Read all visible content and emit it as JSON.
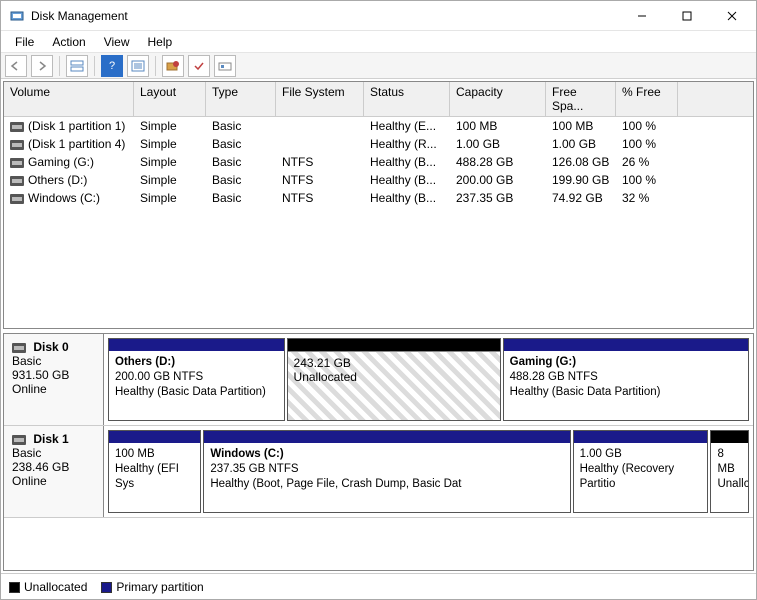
{
  "window": {
    "title": "Disk Management"
  },
  "menu": {
    "file": "File",
    "action": "Action",
    "view": "View",
    "help": "Help"
  },
  "list": {
    "headers": {
      "volume": "Volume",
      "layout": "Layout",
      "type": "Type",
      "filesystem": "File System",
      "status": "Status",
      "capacity": "Capacity",
      "freespace": "Free Spa...",
      "pctfree": "% Free"
    },
    "rows": [
      {
        "volume": "(Disk 1 partition 1)",
        "layout": "Simple",
        "type": "Basic",
        "fs": "",
        "status": "Healthy (E...",
        "capacity": "100 MB",
        "free": "100 MB",
        "pfree": "100 %"
      },
      {
        "volume": "(Disk 1 partition 4)",
        "layout": "Simple",
        "type": "Basic",
        "fs": "",
        "status": "Healthy (R...",
        "capacity": "1.00 GB",
        "free": "1.00 GB",
        "pfree": "100 %"
      },
      {
        "volume": "Gaming (G:)",
        "layout": "Simple",
        "type": "Basic",
        "fs": "NTFS",
        "status": "Healthy (B...",
        "capacity": "488.28 GB",
        "free": "126.08 GB",
        "pfree": "26 %"
      },
      {
        "volume": "Others (D:)",
        "layout": "Simple",
        "type": "Basic",
        "fs": "NTFS",
        "status": "Healthy (B...",
        "capacity": "200.00 GB",
        "free": "199.90 GB",
        "pfree": "100 %"
      },
      {
        "volume": "Windows (C:)",
        "layout": "Simple",
        "type": "Basic",
        "fs": "NTFS",
        "status": "Healthy (B...",
        "capacity": "237.35 GB",
        "free": "74.92 GB",
        "pfree": "32 %"
      }
    ]
  },
  "disks": {
    "d0": {
      "name": "Disk 0",
      "type": "Basic",
      "size": "931.50 GB",
      "status": "Online",
      "p0": {
        "name": "Others  (D:)",
        "info": "200.00 GB NTFS",
        "status": "Healthy (Basic Data Partition)"
      },
      "p1": {
        "size": "243.21 GB",
        "status": "Unallocated"
      },
      "p2": {
        "name": "Gaming  (G:)",
        "info": "488.28 GB NTFS",
        "status": "Healthy (Basic Data Partition)"
      }
    },
    "d1": {
      "name": "Disk 1",
      "type": "Basic",
      "size": "238.46 GB",
      "status": "Online",
      "p0": {
        "size": "100 MB",
        "status": "Healthy (EFI Sys"
      },
      "p1": {
        "name": "Windows  (C:)",
        "info": "237.35 GB NTFS",
        "status": "Healthy (Boot, Page File, Crash Dump, Basic Dat"
      },
      "p2": {
        "size": "1.00 GB",
        "status": "Healthy (Recovery Partitio"
      },
      "p3": {
        "size": "8 MB",
        "status": "Unallc"
      }
    }
  },
  "legend": {
    "unallocated": "Unallocated",
    "primary": "Primary partition"
  }
}
